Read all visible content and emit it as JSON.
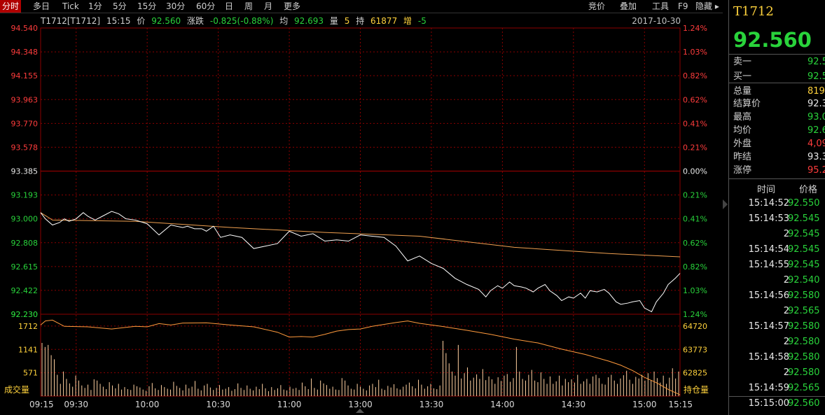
{
  "toolbar": {
    "tabs": [
      "分时",
      "多日",
      "Tick",
      "1分",
      "5分",
      "15分",
      "30分",
      "60分",
      "日",
      "周",
      "月",
      "更多"
    ],
    "right_tools": [
      "竞价",
      "叠加",
      "工具",
      "F9",
      "隐藏"
    ]
  },
  "info": {
    "symbol": "T1712[T1712]",
    "time": "15:15",
    "price_label": "价",
    "price": "92.560",
    "change_label": "涨跌",
    "change": "-0.825(-0.88%)",
    "avg_label": "均",
    "avg": "92.693",
    "vol_label": "量",
    "vol": "5",
    "oi_label": "持",
    "oi": "61877",
    "inc_label": "增",
    "inc": "-5",
    "date": "2017-10-30"
  },
  "colors": {
    "up": "#ff3c3c",
    "down": "#29d33b",
    "neutral": "#e8e8e8",
    "avg_line": "#f0a050",
    "price_line": "#ffffff",
    "grid": "#8b0000",
    "volume": "#ffd0a0",
    "oi_line": "#ff9a3c",
    "label_yellow": "#ffd23c"
  },
  "chart_data": {
    "type": "line",
    "x_labels": [
      "09:15",
      "09:30",
      "10:00",
      "10:30",
      "11:00",
      "13:00",
      "13:30",
      "14:00",
      "14:30",
      "15:00",
      "15:15"
    ],
    "price_axis": {
      "ylim": [
        92.23,
        94.54
      ],
      "ticks": [
        "94.540",
        "94.348",
        "94.155",
        "93.963",
        "93.770",
        "93.578",
        "93.385",
        "93.193",
        "93.000",
        "92.808",
        "92.615",
        "92.422",
        "92.230"
      ],
      "pct_ticks": [
        "1.24%",
        "1.03%",
        "0.82%",
        "0.62%",
        "0.41%",
        "0.21%",
        "0.00%",
        "0.21%",
        "0.41%",
        "0.62%",
        "0.82%",
        "1.03%",
        "1.24%"
      ],
      "prev_settle": 93.385
    },
    "price_series": {
      "x": [
        0,
        2,
        5,
        8,
        10,
        12,
        15,
        18,
        20,
        23,
        26,
        30,
        33,
        36,
        40,
        45,
        50,
        55,
        60,
        62,
        65,
        68,
        70,
        73,
        76,
        80,
        85,
        90,
        95,
        100,
        105,
        110,
        115,
        120,
        125,
        130,
        135,
        140,
        145,
        150,
        155,
        160,
        165,
        170,
        175,
        180,
        185,
        188,
        190,
        193,
        195,
        198,
        200,
        203,
        205,
        208,
        210,
        213,
        215,
        218,
        220,
        223,
        225,
        228,
        230,
        232,
        235,
        238,
        240,
        243,
        245,
        248,
        250,
        253,
        255,
        258,
        260,
        263,
        265,
        268,
        270
      ],
      "y": [
        93.05,
        93.0,
        92.95,
        92.97,
        93.0,
        92.98,
        93.0,
        93.05,
        93.02,
        92.99,
        93.02,
        93.06,
        93.04,
        93.0,
        92.99,
        92.96,
        92.87,
        92.95,
        92.93,
        92.94,
        92.92,
        92.92,
        92.9,
        92.94,
        92.85,
        92.87,
        92.85,
        92.76,
        92.78,
        92.8,
        92.9,
        92.86,
        92.88,
        92.82,
        92.83,
        92.82,
        92.87,
        92.86,
        92.85,
        92.78,
        92.66,
        92.7,
        92.64,
        92.6,
        92.52,
        92.47,
        92.43,
        92.37,
        92.42,
        92.46,
        92.44,
        92.49,
        92.46,
        92.45,
        92.44,
        92.41,
        92.44,
        92.47,
        92.42,
        92.38,
        92.34,
        92.37,
        92.36,
        92.4,
        92.36,
        92.42,
        92.41,
        92.43,
        92.4,
        92.33,
        92.31,
        92.32,
        92.33,
        92.34,
        92.28,
        92.25,
        92.33,
        92.4,
        92.47,
        92.52,
        92.56
      ]
    },
    "avg_series": {
      "x": [
        0,
        5,
        40,
        80,
        120,
        160,
        200,
        240,
        270
      ],
      "y": [
        93.05,
        92.99,
        92.98,
        92.93,
        92.89,
        92.86,
        92.77,
        92.72,
        92.693
      ]
    },
    "volume_axis": {
      "ticks_left": [
        "1712",
        "1141",
        "571"
      ],
      "ticks_right": [
        "64720",
        "63773",
        "62825"
      ],
      "label_left": "成交量",
      "label_right": "持仓量",
      "vmax": 2000,
      "oi_min": 62400,
      "oi_max": 65450
    },
    "volume": [
      1300,
      1200,
      1250,
      1000,
      900,
      520,
      300,
      600,
      420,
      310,
      230,
      500,
      380,
      260,
      200,
      280,
      150,
      410,
      380,
      300,
      230,
      170,
      340,
      260,
      190,
      300,
      160,
      220,
      170,
      150,
      280,
      240,
      210,
      160,
      130,
      240,
      320,
      190,
      150,
      270,
      220,
      180,
      160,
      350,
      250,
      200,
      140,
      280,
      190,
      230,
      370,
      180,
      140,
      260,
      300,
      210,
      150,
      200,
      270,
      160,
      180,
      220,
      130,
      170,
      310,
      200,
      150,
      260,
      180,
      140,
      230,
      170,
      300,
      190,
      120,
      220,
      150,
      190,
      270,
      160,
      140,
      230,
      180,
      200,
      150,
      330,
      240,
      170,
      430,
      200,
      160,
      380,
      310,
      270,
      180,
      230,
      160,
      150,
      440,
      380,
      260,
      180,
      160,
      300,
      230,
      180,
      140,
      260,
      300,
      220,
      400,
      180,
      150,
      250,
      210,
      290,
      190,
      160,
      230,
      280,
      330,
      240,
      190,
      400,
      280,
      180,
      240,
      300,
      190,
      170,
      260,
      1350,
      1050,
      800,
      600,
      500,
      1250,
      430,
      560,
      700,
      380,
      450,
      530,
      420,
      660,
      390,
      480,
      410,
      300,
      460,
      370,
      500,
      540,
      350,
      440,
      1200,
      600,
      420,
      380,
      520,
      640,
      380,
      340,
      580,
      420,
      300,
      480,
      300,
      360,
      500,
      260,
      420,
      340,
      410,
      330,
      520,
      300,
      360,
      420,
      300,
      480,
      520,
      440,
      300,
      280,
      460,
      520,
      380,
      300,
      430,
      510,
      620,
      400,
      300,
      470,
      430,
      520,
      380,
      560,
      390,
      600,
      440,
      330,
      500,
      300,
      450,
      680,
      430,
      600
    ],
    "oi_series": {
      "x": [
        0,
        2,
        5,
        10,
        20,
        30,
        40,
        45,
        50,
        55,
        60,
        70,
        80,
        90,
        100,
        105,
        110,
        115,
        120,
        125,
        130,
        135,
        140,
        150,
        155,
        160,
        170,
        180,
        190,
        200,
        210,
        220,
        230,
        240,
        245,
        250,
        255,
        260,
        265,
        270
      ],
      "y": [
        65050,
        65200,
        65230,
        65000,
        64980,
        64900,
        65000,
        64980,
        65100,
        65050,
        65120,
        65130,
        65050,
        64980,
        64780,
        64600,
        64620,
        64600,
        64700,
        64820,
        64880,
        64900,
        65000,
        65140,
        65200,
        65110,
        64990,
        64850,
        64700,
        64520,
        64380,
        64150,
        63950,
        63700,
        63550,
        63350,
        63100,
        62900,
        62650,
        62450
      ]
    },
    "grid": true
  },
  "sidebar": {
    "title": "T1712",
    "price": "92.560",
    "quote_rows": [
      {
        "k": "卖一",
        "v": "92.5",
        "c": "down"
      },
      {
        "k": "买一",
        "v": "92.5",
        "c": "down"
      },
      {
        "k": "总量",
        "v": "819",
        "c": "yellow"
      },
      {
        "k": "结算价",
        "v": "92.3",
        "c": "neutral"
      },
      {
        "k": "最高",
        "v": "93.0",
        "c": "down"
      },
      {
        "k": "均价",
        "v": "92.6",
        "c": "down"
      },
      {
        "k": "外盘",
        "v": "4,09",
        "c": "up"
      },
      {
        "k": "昨结",
        "v": "93.3",
        "c": "neutral"
      },
      {
        "k": "涨停",
        "v": "95.2",
        "c": "up"
      }
    ],
    "tick_header": {
      "time": "时间",
      "price": "价格"
    },
    "ticks": [
      {
        "t": "15:14:52",
        "p": "92.550"
      },
      {
        "t": "15:14:53",
        "p": "92.545"
      },
      {
        "t": "2",
        "p": "92.545"
      },
      {
        "t": "15:14:54",
        "p": "92.545"
      },
      {
        "t": "15:14:55",
        "p": "92.545"
      },
      {
        "t": "2",
        "p": "92.540"
      },
      {
        "t": "15:14:56",
        "p": "92.580"
      },
      {
        "t": "2",
        "p": "92.565"
      },
      {
        "t": "15:14:57",
        "p": "92.580"
      },
      {
        "t": "2",
        "p": "92.580"
      },
      {
        "t": "15:14:58",
        "p": "92.580"
      },
      {
        "t": "2",
        "p": "92.580"
      },
      {
        "t": "15:14:59",
        "p": "92.565"
      },
      {
        "t": "15:15:00",
        "p": "92.560"
      }
    ]
  }
}
